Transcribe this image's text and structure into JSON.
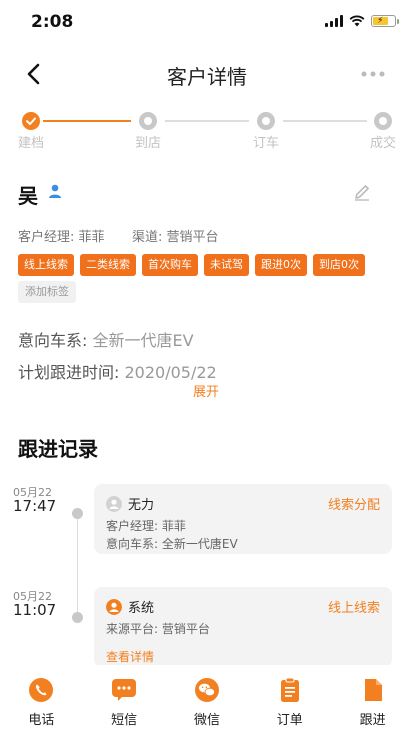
{
  "status_bar": {
    "time": "2:08"
  },
  "nav": {
    "title": "客户详情"
  },
  "steps": [
    {
      "label": "建档",
      "state": "done"
    },
    {
      "label": "到店",
      "state": "todo"
    },
    {
      "label": "订车",
      "state": "todo"
    },
    {
      "label": "成交",
      "state": "todo"
    }
  ],
  "customer": {
    "name": "吴",
    "manager": "客户经理: 菲菲",
    "channel": "渠道: 营销平台",
    "tags": [
      "线上线索",
      "二类线索",
      "首次购车",
      "未试驾",
      "跟进0次",
      "到店0次"
    ],
    "add_tag": "添加标签",
    "intent_label": "意向车系: ",
    "intent_value": "全新一代唐EV",
    "plan_label": "计划跟进时间: ",
    "plan_value": "2020/05/22",
    "expand": "展开"
  },
  "records": {
    "title": "跟进记录",
    "items": [
      {
        "date": "05月22",
        "time": "17:47",
        "author": "无力",
        "type": "线索分配",
        "lines": [
          "客户经理: 菲菲",
          "意向车系: 全新一代唐EV"
        ],
        "link": ""
      },
      {
        "date": "05月22",
        "time": "11:07",
        "author": "系统",
        "type": "线上线索",
        "lines": [
          "来源平台: 营销平台"
        ],
        "link": "查看详情"
      }
    ]
  },
  "tabbar": [
    "电话",
    "短信",
    "微信",
    "订单",
    "跟进"
  ],
  "colors": {
    "accent": "#f28020",
    "tag_bg": "#f0701b",
    "card_bg": "#f3f3f3"
  }
}
